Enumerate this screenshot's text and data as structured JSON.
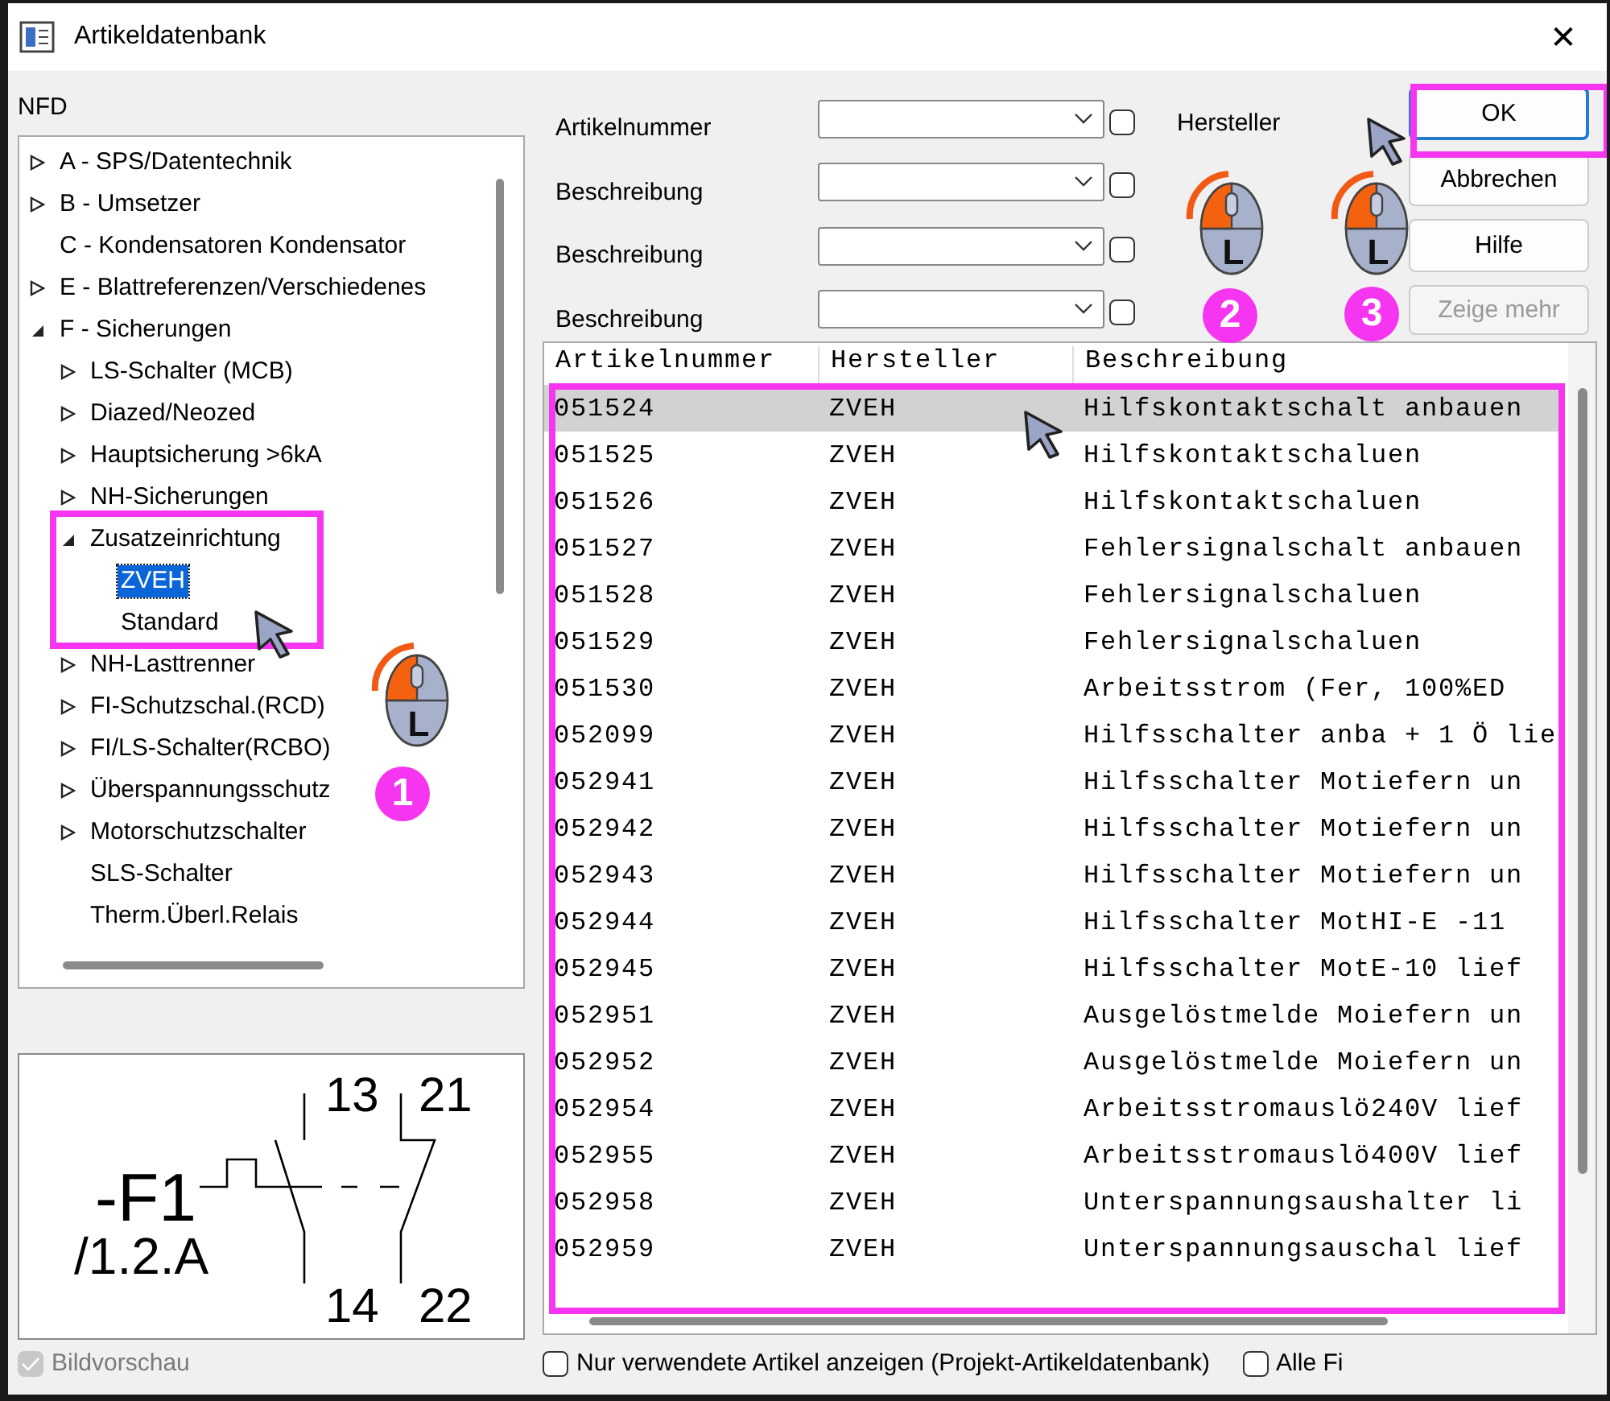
{
  "window": {
    "title": "Artikeldatenbank",
    "close": "✕"
  },
  "tree": {
    "label": "NFD",
    "items": [
      {
        "label": "A - SPS/Datentechnik",
        "expanded": false,
        "selected": false
      },
      {
        "label": "B - Umsetzer",
        "expanded": false,
        "selected": false
      },
      {
        "label": "C - Kondensatoren Kondensator",
        "selected": false
      },
      {
        "label": "E - Blattreferenzen/Verschiedenes",
        "expanded": false,
        "selected": false
      },
      {
        "label": "F - Sicherungen",
        "expanded": true,
        "selected": false,
        "children": [
          {
            "label": "LS-Schalter (MCB)",
            "expanded": false,
            "selected": false
          },
          {
            "label": "Diazed/Neozed",
            "expanded": false,
            "selected": false
          },
          {
            "label": "Hauptsicherung >6kA",
            "expanded": false,
            "selected": false
          },
          {
            "label": "NH-Sicherungen",
            "expanded": false,
            "selected": false
          },
          {
            "label": "Zusatzeinrichtung",
            "expanded": true,
            "selected": false,
            "children": [
              {
                "label": "ZVEH",
                "selected": true
              },
              {
                "label": "Standard",
                "selected": false
              }
            ]
          },
          {
            "label": "NH-Lasttrenner",
            "expanded": false,
            "selected": false
          },
          {
            "label": "FI-Schutzschal.(RCD)",
            "expanded": false,
            "selected": false
          },
          {
            "label": "FI/LS-Schalter(RCBO)",
            "expanded": false,
            "selected": false
          },
          {
            "label": "Überspannungsschutz",
            "expanded": false,
            "selected": false
          },
          {
            "label": "Motorschutzschalter",
            "expanded": false,
            "selected": false
          },
          {
            "label": "SLS-Schalter",
            "selected": false
          },
          {
            "label": "Therm.Überl.Relais",
            "selected": false
          }
        ]
      }
    ]
  },
  "preview": {
    "tag": "-F1",
    "ref": "/1.2.A",
    "terminals": [
      "13",
      "21",
      "14",
      "22"
    ],
    "toggle": {
      "label": "Bildvorschau",
      "checked": true,
      "disabled": true
    }
  },
  "filters": [
    {
      "label": "Artikelnummer",
      "checked": false
    },
    {
      "label": "Beschreibung",
      "checked": false
    },
    {
      "label": "Beschreibung",
      "checked": false
    },
    {
      "label": "Beschreibung",
      "checked": false
    }
  ],
  "manufacturer_label": "Hersteller",
  "buttons": [
    {
      "label": "OK",
      "focused": true,
      "disabled": false
    },
    {
      "label": "Abbrechen",
      "focused": false,
      "disabled": false
    },
    {
      "label": "Hilfe",
      "focused": false,
      "disabled": false
    },
    {
      "label": "Zeige mehr",
      "focused": false,
      "disabled": true
    }
  ],
  "table": {
    "columns": [
      "Artikelnummer",
      "Hersteller",
      "Beschreibung"
    ],
    "rows": [
      {
        "cells": [
          "051524",
          "ZVEH",
          "Hilfskontaktschalt anbauen"
        ],
        "selected": true
      },
      {
        "cells": [
          "051525",
          "ZVEH",
          "Hilfskontaktschaluen"
        ],
        "selected": false
      },
      {
        "cells": [
          "051526",
          "ZVEH",
          "Hilfskontaktschaluen"
        ],
        "selected": false
      },
      {
        "cells": [
          "051527",
          "ZVEH",
          "Fehlersignalschalt anbauen"
        ],
        "selected": false
      },
      {
        "cells": [
          "051528",
          "ZVEH",
          "Fehlersignalschaluen"
        ],
        "selected": false
      },
      {
        "cells": [
          "051529",
          "ZVEH",
          "Fehlersignalschaluen"
        ],
        "selected": false
      },
      {
        "cells": [
          "051530",
          "ZVEH",
          "Arbeitsstrom (Fer,  100%ED"
        ],
        "selected": false
      },
      {
        "cells": [
          "052099",
          "ZVEH",
          "Hilfsschalter anba + 1 Ö lie"
        ],
        "selected": false
      },
      {
        "cells": [
          "052941",
          "ZVEH",
          "Hilfsschalter Motiefern un"
        ],
        "selected": false
      },
      {
        "cells": [
          "052942",
          "ZVEH",
          "Hilfsschalter Motiefern un"
        ],
        "selected": false
      },
      {
        "cells": [
          "052943",
          "ZVEH",
          "Hilfsschalter Motiefern un"
        ],
        "selected": false
      },
      {
        "cells": [
          "052944",
          "ZVEH",
          "Hilfsschalter MotHI-E -11"
        ],
        "selected": false
      },
      {
        "cells": [
          "052945",
          "ZVEH",
          "Hilfsschalter MotE-10 lief"
        ],
        "selected": false
      },
      {
        "cells": [
          "052951",
          "ZVEH",
          "Ausgelöstmelde Moiefern un"
        ],
        "selected": false
      },
      {
        "cells": [
          "052952",
          "ZVEH",
          "Ausgelöstmelde Moiefern un"
        ],
        "selected": false
      },
      {
        "cells": [
          "052954",
          "ZVEH",
          "Arbeitsstromauslö240V lief"
        ],
        "selected": false
      },
      {
        "cells": [
          "052955",
          "ZVEH",
          "Arbeitsstromauslö400V lief"
        ],
        "selected": false
      },
      {
        "cells": [
          "052958",
          "ZVEH",
          "Unterspannungsaushalter li"
        ],
        "selected": false
      },
      {
        "cells": [
          "052959",
          "ZVEH",
          "Unterspannungsauschal lief"
        ],
        "selected": false
      }
    ]
  },
  "options": [
    {
      "label": "Nur verwendete Artikel anzeigen (Projekt-Artikeldatenbank)",
      "checked": false
    },
    {
      "label": "Alle Fi",
      "checked": false
    }
  ],
  "annotations": [
    {
      "number": "1",
      "mouse_label": "L"
    },
    {
      "number": "2",
      "mouse_label": "L"
    },
    {
      "number": "3",
      "mouse_label": "L"
    }
  ]
}
